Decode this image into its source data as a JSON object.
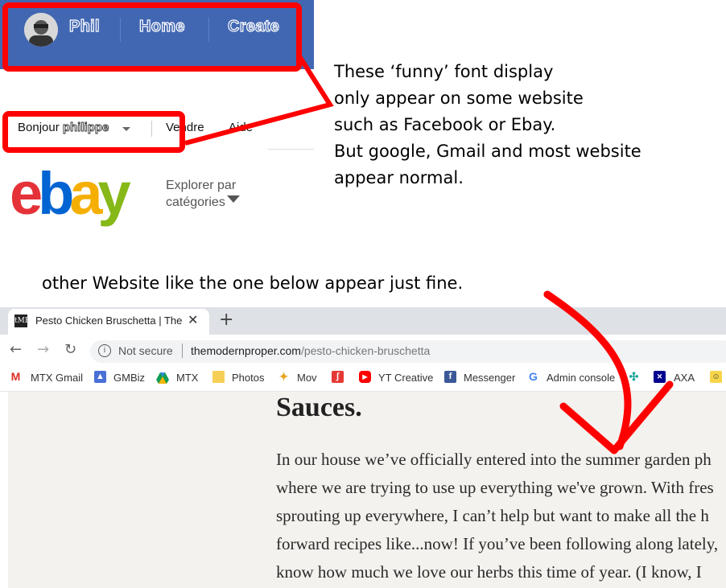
{
  "facebook": {
    "nav": [
      "Phil",
      "Home",
      "Create"
    ]
  },
  "ebay": {
    "greeting": "Bonjour",
    "username": "philippe",
    "links": [
      "Vendre",
      "Aide"
    ],
    "logo": {
      "e": "e",
      "b": "b",
      "a": "a",
      "y": "y"
    },
    "explore_line1": "Explorer par",
    "explore_line2": "catégories"
  },
  "annotation": {
    "top": "These ‘funny’ font display\nonly appear on some website\nsuch as Facebook or Ebay.\nBut google, Gmail and most website\nappear normal.",
    "middle": "other Website like the one below appear just fine."
  },
  "browser": {
    "tab_title": "Pesto Chicken Bruschetta | The M",
    "favicon": "tMP",
    "security": "Not secure",
    "url_domain": "themodernproper.com",
    "url_path": "/pesto-chicken-bruschetta",
    "bookmarks": [
      {
        "label": "MTX Gmail",
        "icon": "gmail-icon"
      },
      {
        "label": "GMBiz",
        "icon": "gmbiz-icon"
      },
      {
        "label": "MTX",
        "icon": "drive-icon"
      },
      {
        "label": "Photos",
        "icon": "folder-icon"
      },
      {
        "label": "Mov",
        "icon": "star-icon"
      },
      {
        "label": "",
        "icon": "red-app-icon"
      },
      {
        "label": "YT Creative",
        "icon": "youtube-icon"
      },
      {
        "label": "Messenger",
        "icon": "facebook-icon"
      },
      {
        "label": "Admin console",
        "icon": "google-icon"
      },
      {
        "label": "",
        "icon": "pinwheel-icon"
      },
      {
        "label": "AXA",
        "icon": "axa-icon"
      }
    ]
  },
  "article": {
    "heading": "Sauces.",
    "lines": [
      "In our house we’ve officially entered into the summer garden ph",
      "where we are trying to use up everything we've grown. With fres",
      "sprouting up everywhere, I can’t help but want to make all the h",
      "forward recipes like...now! If you’ve been following along lately,",
      "know how much we love our herbs this time of year. (I know, I"
    ]
  },
  "colors": {
    "facebook_blue": "#4267b2",
    "highlight_red": "#ff0000",
    "ebay_red": "#e53238",
    "ebay_blue": "#0064d2",
    "ebay_yellow": "#f5af02",
    "ebay_green": "#86b817",
    "page_bg": "#f4f2ee"
  }
}
